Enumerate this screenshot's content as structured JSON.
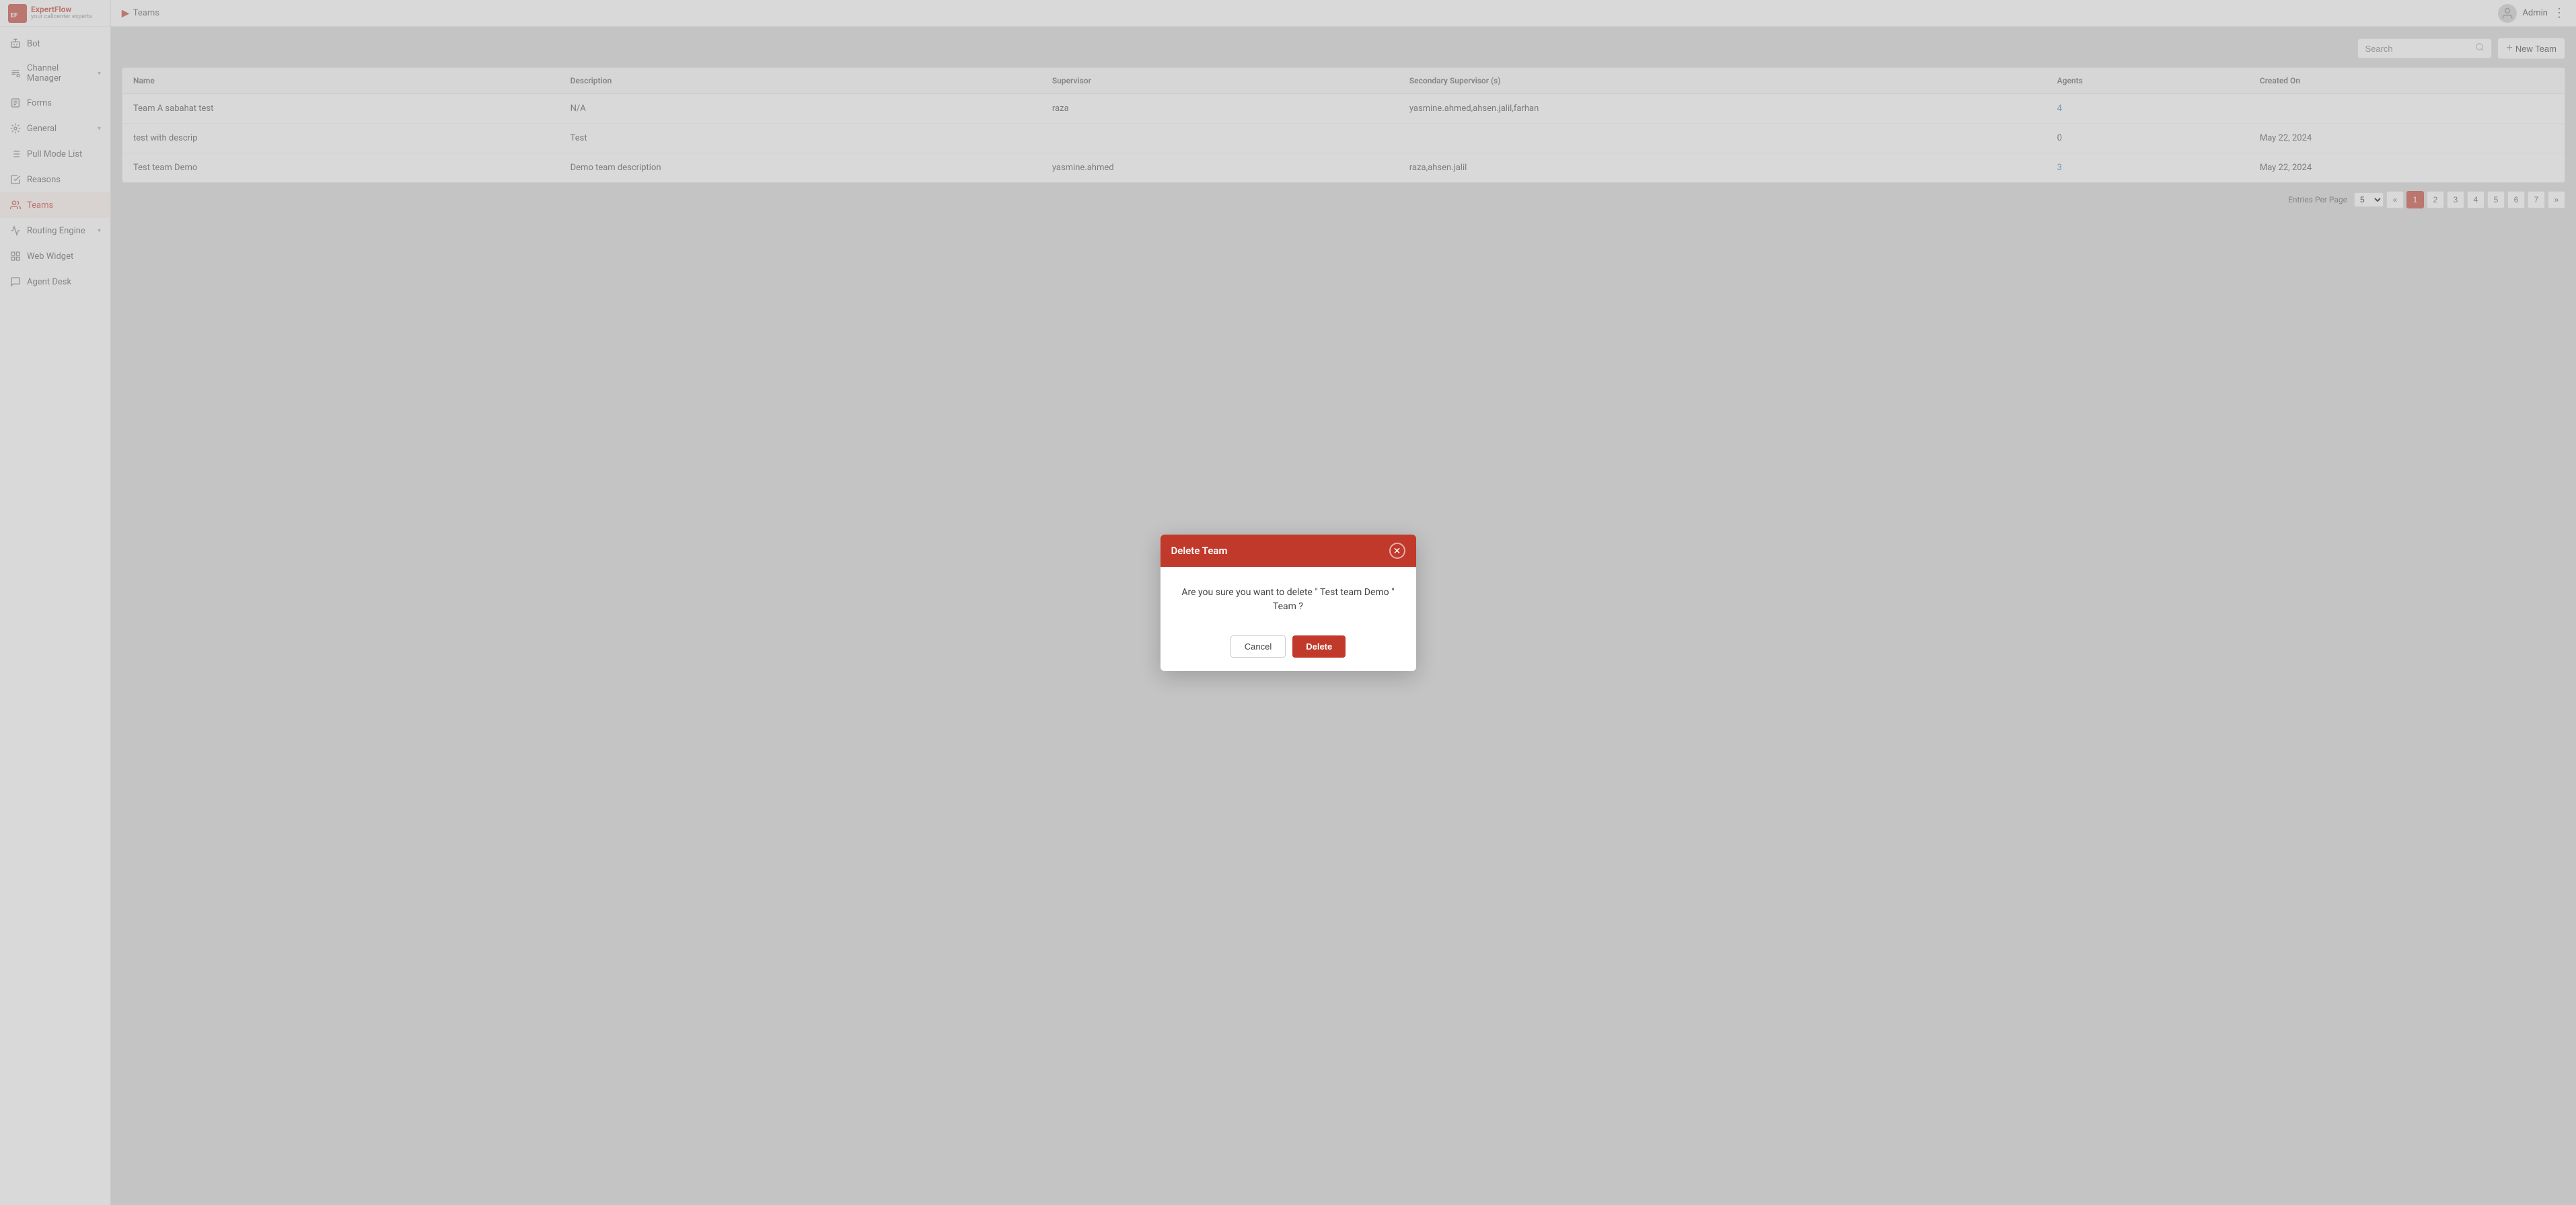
{
  "app": {
    "name": "ExpertFlow",
    "tagline": "your callcenter experts"
  },
  "topbar": {
    "breadcrumb": "Teams",
    "user": "Admin"
  },
  "sidebar": {
    "items": [
      {
        "id": "bot",
        "label": "Bot",
        "icon": "bot-icon",
        "active": false,
        "hasChevron": false
      },
      {
        "id": "channel-manager",
        "label": "Channel Manager",
        "icon": "channel-icon",
        "active": false,
        "hasChevron": true
      },
      {
        "id": "forms",
        "label": "Forms",
        "icon": "forms-icon",
        "active": false,
        "hasChevron": false
      },
      {
        "id": "general",
        "label": "General",
        "icon": "general-icon",
        "active": false,
        "hasChevron": true
      },
      {
        "id": "pull-mode-list",
        "label": "Pull Mode List",
        "icon": "list-icon",
        "active": false,
        "hasChevron": false
      },
      {
        "id": "reasons",
        "label": "Reasons",
        "icon": "reasons-icon",
        "active": false,
        "hasChevron": false
      },
      {
        "id": "teams",
        "label": "Teams",
        "icon": "teams-icon",
        "active": true,
        "hasChevron": false
      },
      {
        "id": "routing-engine",
        "label": "Routing Engine",
        "icon": "routing-icon",
        "active": false,
        "hasChevron": true
      },
      {
        "id": "web-widget",
        "label": "Web Widget",
        "icon": "widget-icon",
        "active": false,
        "hasChevron": false
      },
      {
        "id": "agent-desk",
        "label": "Agent Desk",
        "icon": "agent-icon",
        "active": false,
        "hasChevron": false
      }
    ]
  },
  "toolbar": {
    "search_placeholder": "Search",
    "new_team_label": "+ New Team"
  },
  "table": {
    "columns": [
      "Name",
      "Description",
      "Supervisor",
      "Secondary Supervisor (s)",
      "Agents",
      "Created On"
    ],
    "rows": [
      {
        "name": "Team A sabahat test",
        "description": "N/A",
        "supervisor": "raza",
        "secondary_supervisor": "yasmine.ahmed,ahsen.jalil,farhan",
        "agents": "4",
        "agents_link": true,
        "created_on": ""
      },
      {
        "name": "test with descrip",
        "description": "Test",
        "supervisor": "",
        "secondary_supervisor": "",
        "agents": "0",
        "agents_link": false,
        "created_on": "May 22, 2024"
      },
      {
        "name": "Test team Demo",
        "description": "Demo team description",
        "supervisor": "yasmine.ahmed",
        "secondary_supervisor": "raza,ahsen.jalil",
        "agents": "3",
        "agents_link": true,
        "created_on": "May 22, 2024"
      }
    ]
  },
  "pagination": {
    "entries_per_page_label": "Entries Per Page",
    "per_page_value": "5",
    "pages": [
      "1",
      "2",
      "3",
      "4",
      "5",
      "6",
      "7"
    ],
    "current_page": "1"
  },
  "modal": {
    "title": "Delete Team",
    "message": "Are you sure you want to delete \" Test team Demo \" Team ?",
    "cancel_label": "Cancel",
    "delete_label": "Delete"
  }
}
